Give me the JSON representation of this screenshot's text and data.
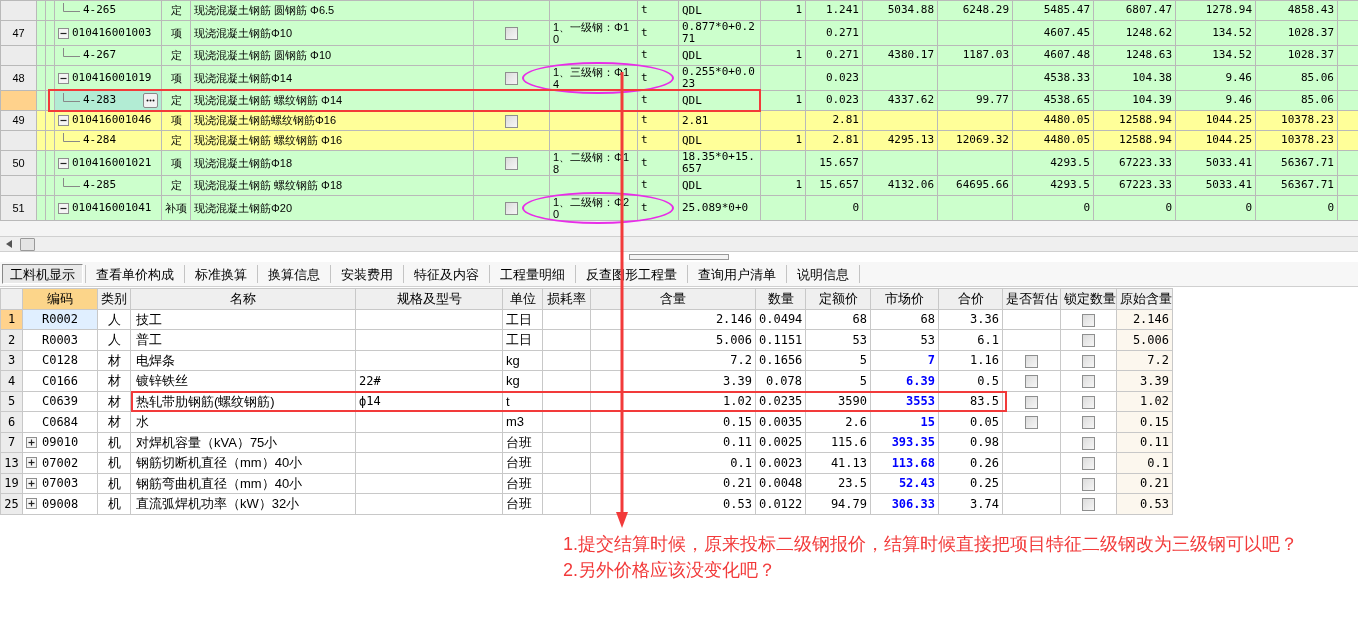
{
  "top_grid": {
    "rows": [
      {
        "kind": "quota",
        "code": "4-265",
        "type": "定",
        "name": "现浇混凝土钢筋 圆钢筋 Φ6.5",
        "unit": "t",
        "expression": "QDL",
        "column_9": "1",
        "quantity": "1.241",
        "column_11": "5034.88",
        "column_12": "6248.29",
        "column_13": "5485.47",
        "column_14": "6807.47",
        "column_15": "1278.94",
        "column_16": "4858.43",
        "highlighted": false,
        "selected": false
      },
      {
        "kind": "bill",
        "number": "47",
        "code": "010416001003",
        "type": "项",
        "name": "现浇混凝土钢筋Φ10",
        "checked": false,
        "expanded": true,
        "feature": "1、一级钢：Φ10",
        "unit": "t",
        "expression": "0.877*0+0.271",
        "quantity": "0.271",
        "column_13": "4607.45",
        "column_14": "1248.62",
        "column_15": "134.52",
        "column_16": "1028.37",
        "highlighted": false,
        "selected": false,
        "children": [
          {
            "kind": "quota",
            "code": "4-267",
            "type": "定",
            "name": "现浇混凝土钢筋 圆钢筋 Φ10",
            "unit": "t",
            "expression": "QDL",
            "column_9": "1",
            "quantity": "0.271",
            "column_11": "4380.17",
            "column_12": "1187.03",
            "column_13": "4607.48",
            "column_14": "1248.63",
            "column_15": "134.52",
            "column_16": "1028.37",
            "highlighted": false,
            "selected": false
          }
        ]
      },
      {
        "kind": "bill",
        "number": "48",
        "code": "010416001019",
        "type": "项",
        "name": "现浇混凝土钢筋Φ14",
        "checked": false,
        "expanded": true,
        "feature": "1、三级钢：Φ14",
        "unit": "t",
        "expression": "0.255*0+0.023",
        "quantity": "0.023",
        "column_13": "4538.33",
        "column_14": "104.38",
        "column_15": "9.46",
        "column_16": "85.06",
        "highlighted": false,
        "selected": false,
        "children": [
          {
            "kind": "quota",
            "code": "4-283",
            "type": "定",
            "name": "现浇混凝土钢筋 螺纹钢筋 Φ14",
            "unit": "t",
            "expression": "QDL",
            "column_9": "1",
            "quantity": "0.023",
            "column_11": "4337.62",
            "column_12": "99.77",
            "column_13": "4538.65",
            "column_14": "104.39",
            "column_15": "9.46",
            "column_16": "85.06",
            "highlighted": false,
            "selected": true
          }
        ]
      },
      {
        "kind": "bill",
        "number": "49",
        "code": "010416001046",
        "type": "项",
        "name": "现浇混凝土钢筋螺纹钢筋Φ16",
        "checked": false,
        "expanded": true,
        "unit": "t",
        "expression": "2.81",
        "quantity": "2.81",
        "column_13": "4480.05",
        "column_14": "12588.94",
        "column_15": "1044.25",
        "column_16": "10378.23",
        "highlighted": true,
        "selected": false,
        "children": [
          {
            "kind": "quota",
            "code": "4-284",
            "type": "定",
            "name": "现浇混凝土钢筋 螺纹钢筋 Φ16",
            "unit": "t",
            "expression": "QDL",
            "column_9": "1",
            "quantity": "2.81",
            "column_11": "4295.13",
            "column_12": "12069.32",
            "column_13": "4480.05",
            "column_14": "12588.94",
            "column_15": "1044.25",
            "column_16": "10378.23",
            "highlighted": true,
            "selected": false
          }
        ]
      },
      {
        "kind": "bill",
        "number": "50",
        "code": "010416001021",
        "type": "项",
        "name": "现浇混凝土钢筋Φ18",
        "checked": false,
        "expanded": true,
        "feature": "1、二级钢：Φ18",
        "unit": "t",
        "expression": "18.35*0+15.657",
        "quantity": "15.657",
        "column_13": "4293.5",
        "column_14": "67223.33",
        "column_15": "5033.41",
        "column_16": "56367.71",
        "highlighted": false,
        "selected": false,
        "children": [
          {
            "kind": "quota",
            "code": "4-285",
            "type": "定",
            "name": "现浇混凝土钢筋 螺纹钢筋 Φ18",
            "unit": "t",
            "expression": "QDL",
            "column_9": "1",
            "quantity": "15.657",
            "column_11": "4132.06",
            "column_12": "64695.66",
            "column_13": "4293.5",
            "column_14": "67223.33",
            "column_15": "5033.41",
            "column_16": "56367.71",
            "highlighted": false,
            "selected": false
          }
        ]
      },
      {
        "kind": "bill",
        "number": "51",
        "code": "010416001041",
        "type": "补项",
        "name": "现浇混凝土钢筋Φ20",
        "checked": false,
        "expanded": true,
        "feature": "1、二级钢：Φ20",
        "unit": "t",
        "expression": "25.089*0+0",
        "quantity": "0",
        "column_13": "0",
        "column_14": "0",
        "column_15": "0",
        "column_16": "0",
        "highlighted": false,
        "selected": false
      }
    ]
  },
  "tabs": [
    {
      "label": "工料机显示",
      "selected": true
    },
    {
      "label": "查看单价构成",
      "selected": false
    },
    {
      "label": "标准换算",
      "selected": false
    },
    {
      "label": "换算信息",
      "selected": false
    },
    {
      "label": "安装费用",
      "selected": false
    },
    {
      "label": "特征及内容",
      "selected": false
    },
    {
      "label": "工程量明细",
      "selected": false
    },
    {
      "label": "反查图形工程量",
      "selected": false
    },
    {
      "label": "查询用户清单",
      "selected": false
    },
    {
      "label": "说明信息",
      "selected": false
    }
  ],
  "resource_table": {
    "columns": [
      {
        "label": "编码",
        "selected": true
      },
      {
        "label": "类别",
        "selected": false
      },
      {
        "label": "名称",
        "selected": false
      },
      {
        "label": "规格及型号",
        "selected": false
      },
      {
        "label": "单位",
        "selected": false
      },
      {
        "label": "损耗率",
        "selected": false
      },
      {
        "label": "含量",
        "selected": false
      },
      {
        "label": "数量",
        "selected": false
      },
      {
        "label": "定额价",
        "selected": false
      },
      {
        "label": "市场价",
        "selected": false
      },
      {
        "label": "合价",
        "selected": false
      },
      {
        "label": "是否暂估",
        "selected": false
      },
      {
        "label": "锁定数量",
        "selected": false
      },
      {
        "label": "原始含量",
        "selected": false
      }
    ],
    "rows": [
      {
        "number": "1",
        "code": "R0002",
        "category": "人",
        "name": "技工",
        "unit": "工日",
        "content": "2.146",
        "quantity": "0.0494",
        "quota_price": "68",
        "market_price": "68",
        "price_changed": false,
        "total": "3.36",
        "lock_checked": false,
        "original": "2.146",
        "selected": true
      },
      {
        "number": "2",
        "code": "R0003",
        "category": "人",
        "name": "普工",
        "unit": "工日",
        "content": "5.006",
        "quantity": "0.1151",
        "quota_price": "53",
        "market_price": "53",
        "price_changed": false,
        "total": "6.1",
        "lock_checked": false,
        "original": "5.006",
        "selected": false
      },
      {
        "number": "3",
        "code": "C0128",
        "category": "材",
        "name": "电焊条",
        "unit": "kg",
        "content": "7.2",
        "quantity": "0.1656",
        "quota_price": "5",
        "market_price": "7",
        "price_changed": true,
        "total": "1.16",
        "provisional_checked": false,
        "lock_checked": false,
        "original": "7.2",
        "selected": false
      },
      {
        "number": "4",
        "code": "C0166",
        "category": "材",
        "name": "镀锌铁丝",
        "spec": "22#",
        "unit": "kg",
        "content": "3.39",
        "quantity": "0.078",
        "quota_price": "5",
        "market_price": "6.39",
        "price_changed": true,
        "total": "0.5",
        "provisional_checked": false,
        "lock_checked": false,
        "original": "3.39",
        "selected": false
      },
      {
        "number": "5",
        "code": "C0639",
        "category": "材",
        "name": "热轧带肋钢筋(螺纹钢筋)",
        "spec": "ф14",
        "unit": "t",
        "content": "1.02",
        "quantity": "0.0235",
        "quota_price": "3590",
        "market_price": "3553",
        "price_changed": true,
        "total": "83.5",
        "provisional_checked": false,
        "lock_checked": false,
        "original": "1.02",
        "selected": false
      },
      {
        "number": "6",
        "code": "C0684",
        "category": "材",
        "name": "水",
        "unit": "m3",
        "content": "0.15",
        "quantity": "0.0035",
        "quota_price": "2.6",
        "market_price": "15",
        "price_changed": true,
        "total": "0.05",
        "provisional_checked": false,
        "lock_checked": false,
        "original": "0.15",
        "selected": false
      },
      {
        "number": "7",
        "expanded": false,
        "code": "09010",
        "category": "机",
        "name": "对焊机容量（kVA）75小",
        "unit": "台班",
        "content": "0.11",
        "quantity": "0.0025",
        "quota_price": "115.6",
        "market_price": "393.35",
        "price_changed": true,
        "total": "0.98",
        "lock_checked": false,
        "original": "0.11",
        "selected": false
      },
      {
        "number": "13",
        "expanded": false,
        "code": "07002",
        "category": "机",
        "name": "钢筋切断机直径（mm）40小",
        "unit": "台班",
        "content": "0.1",
        "quantity": "0.0023",
        "quota_price": "41.13",
        "market_price": "113.68",
        "price_changed": true,
        "total": "0.26",
        "lock_checked": false,
        "original": "0.1",
        "selected": false
      },
      {
        "number": "19",
        "expanded": false,
        "code": "07003",
        "category": "机",
        "name": "钢筋弯曲机直径（mm）40小",
        "unit": "台班",
        "content": "0.21",
        "quantity": "0.0048",
        "quota_price": "23.5",
        "market_price": "52.43",
        "price_changed": true,
        "total": "0.25",
        "lock_checked": false,
        "original": "0.21",
        "selected": false
      },
      {
        "number": "25",
        "expanded": false,
        "code": "09008",
        "category": "机",
        "name": "直流弧焊机功率（kW）32小",
        "unit": "台班",
        "content": "0.53",
        "quantity": "0.0122",
        "quota_price": "94.79",
        "market_price": "306.33",
        "price_changed": true,
        "total": "3.74",
        "lock_checked": false,
        "original": "0.53",
        "selected": false
      }
    ]
  },
  "annotation": {
    "lines": [
      "1.提交结算时候，原来投标二级钢报价，结算时候直接把项目特征二级钢改为三级钢可以吧？",
      "2.另外价格应该没变化吧？"
    ]
  }
}
